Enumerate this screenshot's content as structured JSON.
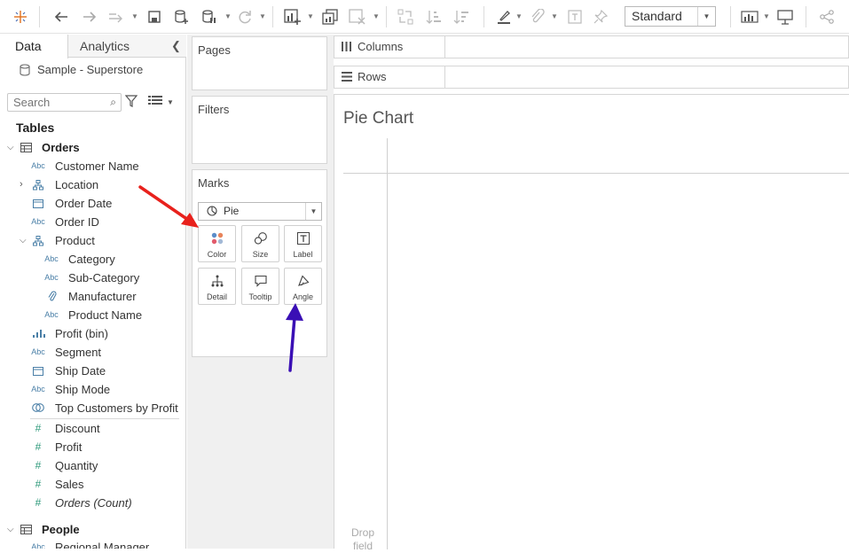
{
  "toolbar": {
    "fit_label": "Standard",
    "icons": [
      "tableau-logo-icon",
      "undo-icon",
      "redo-icon",
      "replay-icon",
      "save-icon",
      "new-datasource-icon",
      "pause-updates-icon",
      "refresh-icon",
      "new-worksheet-icon",
      "duplicate-icon",
      "clear-icon",
      "swap-icon",
      "sort-asc-icon",
      "sort-desc-icon",
      "highlight-icon",
      "group-icon",
      "show-labels-icon",
      "pin-icon",
      "show-me-icon",
      "presentation-icon",
      "share-icon"
    ]
  },
  "data_pane": {
    "tab_data": "Data",
    "tab_analytics": "Analytics",
    "datasource": "Sample - Superstore",
    "search_placeholder": "Search",
    "tables_heading": "Tables",
    "orders_table": "Orders",
    "fields": [
      {
        "icon": "Abc",
        "label": "Customer Name"
      },
      {
        "icon": "hierarchy",
        "label": "Location"
      },
      {
        "icon": "date",
        "label": "Order Date"
      },
      {
        "icon": "Abc",
        "label": "Order ID"
      },
      {
        "icon": "hierarchy",
        "label": "Product"
      },
      {
        "icon": "Abc",
        "label": "Category"
      },
      {
        "icon": "Abc",
        "label": "Sub-Category"
      },
      {
        "icon": "group",
        "label": "Manufacturer"
      },
      {
        "icon": "Abc",
        "label": "Product Name"
      },
      {
        "icon": "bin",
        "label": "Profit (bin)"
      },
      {
        "icon": "Abc",
        "label": "Segment"
      },
      {
        "icon": "date",
        "label": "Ship Date"
      },
      {
        "icon": "Abc",
        "label": "Ship Mode"
      },
      {
        "icon": "set",
        "label": "Top Customers by Profit"
      }
    ],
    "measures": [
      {
        "icon": "#",
        "label": "Discount"
      },
      {
        "icon": "#",
        "label": "Profit"
      },
      {
        "icon": "#",
        "label": "Quantity"
      },
      {
        "icon": "#",
        "label": "Sales"
      },
      {
        "icon": "#",
        "label": "Orders (Count)"
      }
    ],
    "people_table": "People",
    "people_fields": [
      {
        "icon": "Abc",
        "label": "Regional Manager"
      }
    ]
  },
  "cards": {
    "pages": "Pages",
    "filters": "Filters",
    "marks": "Marks",
    "mark_type": "Pie",
    "buttons": {
      "color": "Color",
      "size": "Size",
      "label": "Label",
      "detail": "Detail",
      "tooltip": "Tooltip",
      "angle": "Angle"
    }
  },
  "shelves": {
    "columns": "Columns",
    "rows": "Rows"
  },
  "view": {
    "title": "Pie Chart",
    "drop_field": "Drop field"
  },
  "annotations": {
    "red_arrow_color": "#e8211c",
    "purple_arrow_color": "#3a0fb5"
  }
}
